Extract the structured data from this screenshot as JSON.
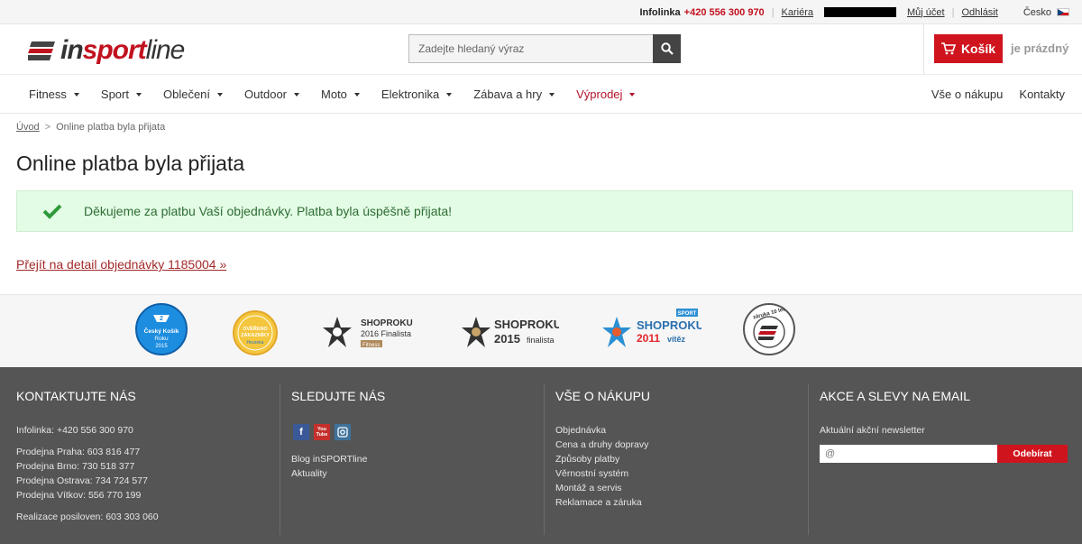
{
  "topbar": {
    "infoline_label": "Infolinka",
    "infoline_phone": "+420 556 300 970",
    "career": "Kariéra",
    "my_account": "Můj účet",
    "logout": "Odhlásit",
    "language": "Česko"
  },
  "header": {
    "logo_in": "in",
    "logo_sport": "sport",
    "logo_line": "line",
    "search_placeholder": "Zadejte hledaný výraz",
    "cart_label": "Košík",
    "cart_status": "je prázdný"
  },
  "nav": {
    "items": [
      {
        "label": "Fitness"
      },
      {
        "label": "Sport"
      },
      {
        "label": "Oblečení"
      },
      {
        "label": "Outdoor"
      },
      {
        "label": "Moto"
      },
      {
        "label": "Elektronika"
      },
      {
        "label": "Zábava a hry"
      },
      {
        "label": "Výprodej"
      }
    ],
    "right": [
      "Vše o nákupu",
      "Kontakty"
    ]
  },
  "breadcrumb": {
    "home": "Úvod",
    "separator": ">",
    "current": "Online platba byla přijata"
  },
  "main": {
    "title": "Online platba byla přijata",
    "success_message": "Děkujeme za platbu Vaší objednávky. Platba byla úspěšně přijata!",
    "order_link": "Přejít na detail objednávky 1185004 »"
  },
  "badges": {
    "kosik": [
      "Český Košík",
      "Roku",
      "2015"
    ],
    "overeno": [
      "OVĚŘENO",
      "ZÁKAZNÍKY",
      "Heureka"
    ],
    "shoproku1": [
      "SHOPROKU",
      "2016 Finalista",
      "Fitness"
    ],
    "shoproku2": [
      "SHOPROKU",
      "2015",
      "finalista"
    ],
    "shoproku3": [
      "SPORT",
      "SHOPROKU",
      "2011",
      "vítěz"
    ],
    "zaruka": "záruka 10 let"
  },
  "footer": {
    "contact": {
      "title": "KONTAKTUJTE NÁS",
      "infoline": "Infolinka: +420 556 300 970",
      "stores": [
        "Prodejna Praha: 603 816 477",
        "Prodejna Brno: 730 518 377",
        "Prodejna Ostrava: 734 724 577",
        "Prodejna Vítkov: 556 770 199"
      ],
      "gyms": "Realizace posiloven: 603 303 060"
    },
    "follow": {
      "title": "SLEDUJTE NÁS",
      "youtube_top": "You",
      "youtube_bottom": "Tube",
      "links": [
        "Blog inSPORTline",
        "Aktuality"
      ]
    },
    "shopping": {
      "title": "VŠE O NÁKUPU",
      "links": [
        "Objednávka",
        "Cena a druhy dopravy",
        "Způsoby platby",
        "Věrnostní systém",
        "Montáž a servis",
        "Reklamace a záruka"
      ]
    },
    "newsletter": {
      "title": "AKCE A SLEVY NA EMAIL",
      "subtitle": "Aktuální akční newsletter",
      "placeholder": "@",
      "button": "Odebírat"
    }
  },
  "colors": {
    "brand_red": "#d0141d",
    "footer_bg": "#555555",
    "success_bg": "#e3fce5",
    "success_text": "#2e6d34"
  }
}
